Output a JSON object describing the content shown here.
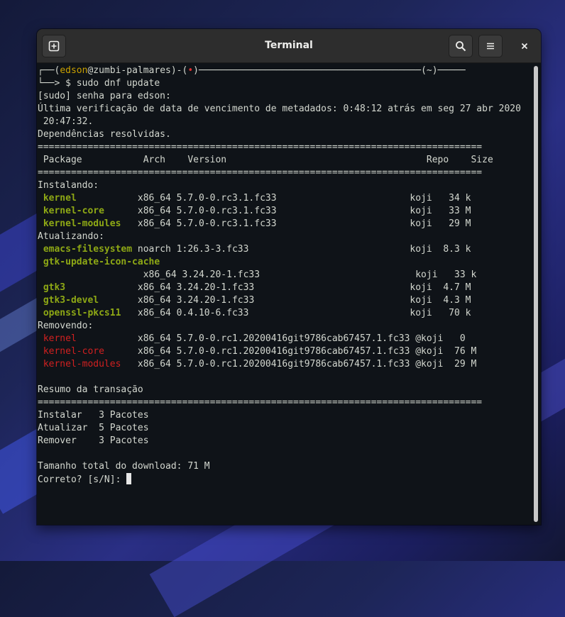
{
  "window": {
    "title": "Terminal",
    "buttons": {
      "new_tab_icon": "new-tab-icon",
      "search_icon": "search-icon",
      "menu_icon": "hamburger-menu-icon",
      "close_icon": "close-icon"
    }
  },
  "colors": {
    "terminal_bg": "#0f1318",
    "terminal_fg": "#d3d7cf",
    "install_pkg": "#8ea815",
    "remove_pkg": "#d02020",
    "user": "#c8a000",
    "prompt_dot": "#e03030"
  },
  "terminal": {
    "prompt": {
      "line1_prefix": "┌──(",
      "user": "edson",
      "host": "@zumbi-palmares",
      "mid": ")-(",
      "dot": "•",
      "tail": ")────────────────────────────────────────(~)─────",
      "line2": "└──> $ sudo dnf update"
    },
    "sudo_line": "[sudo] senha para edson:",
    "meta_line1": "Última verificação de data de vencimento de metadados: 0:48:12 atrás em seg 27 abr 2020",
    "meta_line2": " 20:47:32.",
    "deps_line": "Dependências resolvidas.",
    "separator": "================================================================================",
    "table_header": " Package           Arch    Version                                    Repo    Size",
    "sections": {
      "installing": "Instalando:",
      "upgrading": "Atualizando:",
      "removing": "Removendo:"
    },
    "installing": [
      {
        "name": "kernel",
        "pad": "           ",
        "rest": "x86_64 5.7.0-0.rc3.1.fc33                        koji   34 k"
      },
      {
        "name": "kernel-core",
        "pad": "      ",
        "rest": "x86_64 5.7.0-0.rc3.1.fc33                        koji   33 M"
      },
      {
        "name": "kernel-modules",
        "pad": "   ",
        "rest": "x86_64 5.7.0-0.rc3.1.fc33                        koji   29 M"
      }
    ],
    "upgrading": [
      {
        "name": "emacs-filesystem",
        "pad": " ",
        "rest": "noarch 1:26.3-3.fc33                             koji  8.3 k"
      },
      {
        "name": "gtk-update-icon-cache",
        "pad": "",
        "rest": ""
      },
      {
        "name": "",
        "pad": "                  ",
        "rest": "x86_64 3.24.20-1.fc33                            koji   33 k"
      },
      {
        "name": "gtk3",
        "pad": "             ",
        "rest": "x86_64 3.24.20-1.fc33                            koji  4.7 M"
      },
      {
        "name": "gtk3-devel",
        "pad": "       ",
        "rest": "x86_64 3.24.20-1.fc33                            koji  4.3 M"
      },
      {
        "name": "openssl-pkcs11",
        "pad": "   ",
        "rest": "x86_64 0.4.10-6.fc33                             koji   70 k"
      }
    ],
    "removing": [
      {
        "name": "kernel",
        "pad": "           ",
        "rest": "x86_64 5.7.0-0.rc1.20200416git9786cab67457.1.fc33 @koji   0"
      },
      {
        "name": "kernel-core",
        "pad": "      ",
        "rest": "x86_64 5.7.0-0.rc1.20200416git9786cab67457.1.fc33 @koji  76 M"
      },
      {
        "name": "kernel-modules",
        "pad": "   ",
        "rest": "x86_64 5.7.0-0.rc1.20200416git9786cab67457.1.fc33 @koji  29 M"
      }
    ],
    "summary_title": "Resumo da transação",
    "summary": [
      "Instalar   3 Pacotes",
      "Atualizar  5 Pacotes",
      "Remover    3 Pacotes"
    ],
    "download_total": "Tamanho total do download: 71 M",
    "confirm_prompt": "Correto? [s/N]: "
  }
}
